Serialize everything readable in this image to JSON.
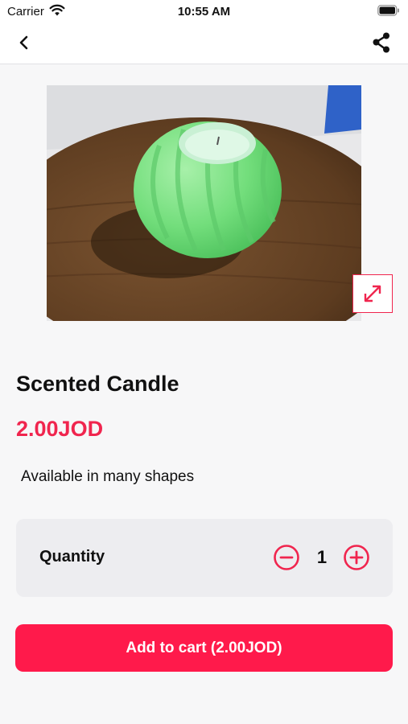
{
  "status_bar": {
    "carrier": "Carrier",
    "time": "10:55 AM",
    "icons": [
      "wifi-icon",
      "battery-icon"
    ]
  },
  "nav": {
    "back_icon": "chevron-left-icon",
    "share_icon": "share-icon"
  },
  "product": {
    "image_alt": "green scented candle on wooden board",
    "expand_icon": "expand-arrows-icon",
    "title": "Scented Candle",
    "price": "2.00JOD",
    "description": "Available in many shapes"
  },
  "quantity": {
    "label": "Quantity",
    "value": "1",
    "minus_icon": "minus-circle-icon",
    "plus_icon": "plus-circle-icon"
  },
  "cart": {
    "button_label": "Add to cart (2.00JOD)"
  },
  "colors": {
    "accent": "#f0254e",
    "button": "#ff1a4b",
    "card_bg": "#ededf0",
    "page_bg": "#f7f7f8"
  }
}
